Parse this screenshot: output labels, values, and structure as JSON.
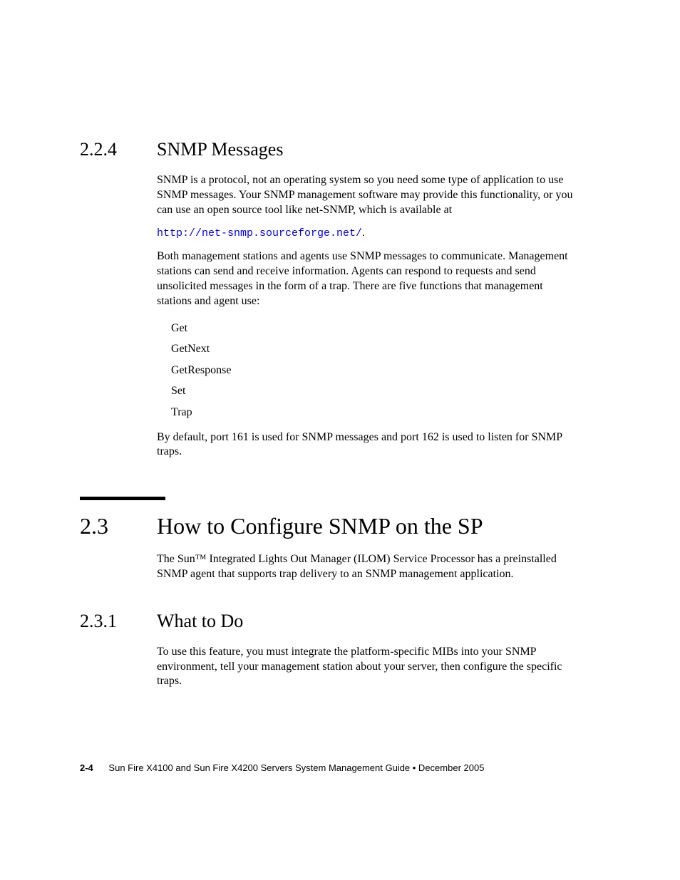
{
  "sec224": {
    "number": "2.2.4",
    "title": "SNMP Messages",
    "para1": "SNMP is a protocol, not an operating system so you need some type of application to use SNMP messages. Your SNMP management software may provide this functionality, or you can use an open source tool like net-SNMP, which is available at",
    "link": "http://net-snmp.sourceforge.net/",
    "para2": "Both management stations and agents use SNMP messages to communicate. Management stations can send and receive information. Agents can respond to requests and send unsolicited messages in the form of a trap. There are five functions that management stations and agent use:",
    "items": {
      "0": "Get",
      "1": "GetNext",
      "2": "GetResponse",
      "3": "Set",
      "4": "Trap"
    },
    "para3": "By default, port 161 is used for SNMP messages and port 162 is used to listen for SNMP traps."
  },
  "sec23": {
    "number": "2.3",
    "title": "How to Configure SNMP on the SP",
    "para1": "The Sun™ Integrated Lights Out Manager (ILOM) Service Processor has a preinstalled SNMP agent that supports trap delivery to an SNMP management application."
  },
  "sec231": {
    "number": "2.3.1",
    "title": "What to Do",
    "para1": "To use this feature, you must integrate the platform-specific MIBs into your SNMP environment, tell your management station about your server, then configure the specific traps."
  },
  "footer": {
    "pagenum": "2-4",
    "text": "Sun Fire X4100 and Sun Fire X4200 Servers System Management Guide • December 2005"
  }
}
